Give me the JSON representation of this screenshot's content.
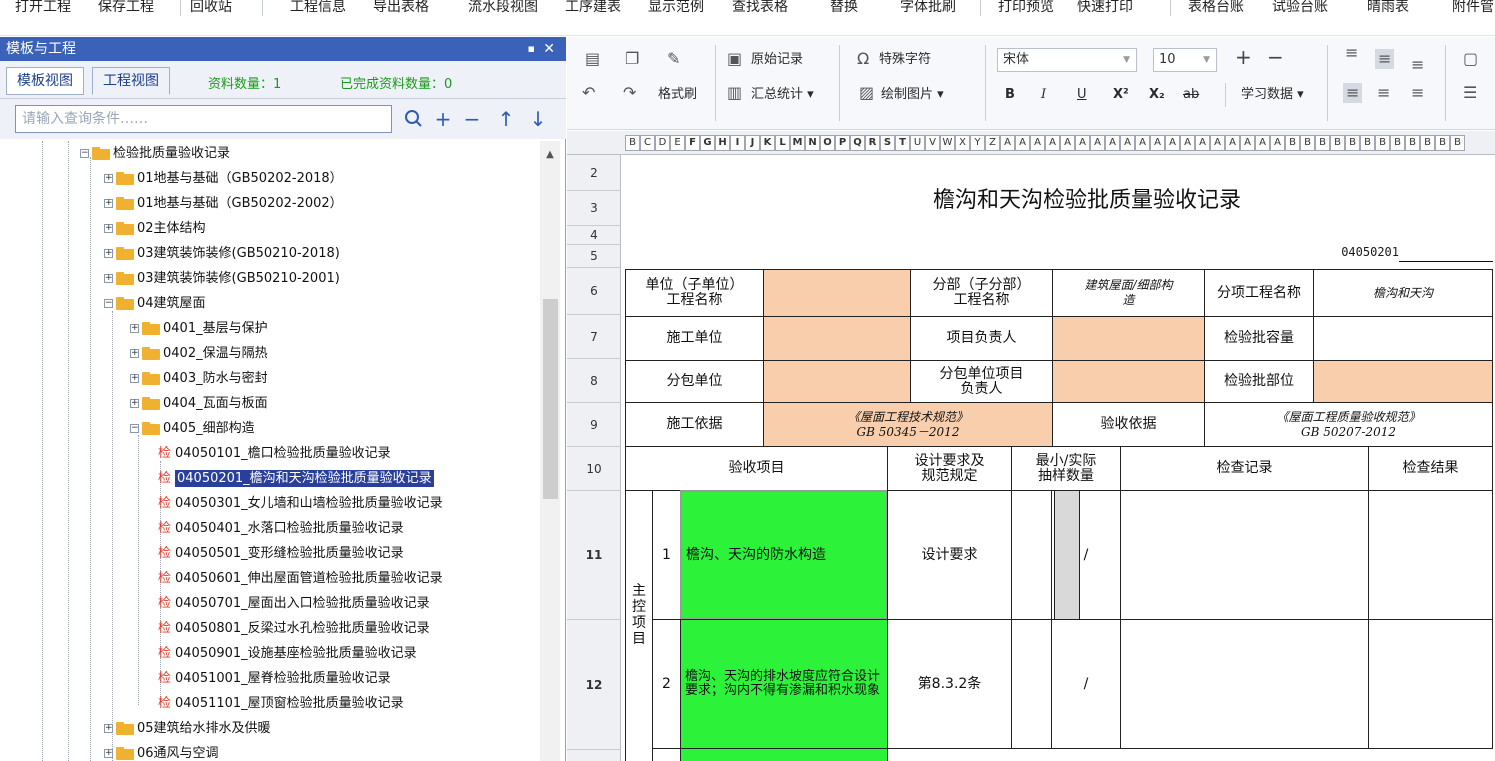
{
  "menu": [
    "打开工程",
    "保存工程",
    "回收站",
    "工程信息",
    "导出表格",
    "流水段视图",
    "工序建表",
    "显示范例",
    "查找表格",
    "替换",
    "字体批刷",
    "打印预览",
    "快速打印",
    "表格台账",
    "试验台账",
    "晴雨表",
    "附件管"
  ],
  "left_panel": {
    "title": "模板与工程",
    "pin": "▪",
    "close": "✕",
    "tabs": [
      "模板视图",
      "工程视图"
    ],
    "count_label": "资料数量：1",
    "done_label": "已完成资料数量：0",
    "search_placeholder": "请输入查询条件……"
  },
  "tree": [
    {
      "label": "检验批质量验收记录",
      "type": "folder",
      "toggle": "−"
    },
    {
      "label": "01地基与基础（GB50202-2018）",
      "type": "folder",
      "toggle": "+"
    },
    {
      "label": "01地基与基础（GB50202-2002）",
      "type": "folder",
      "toggle": "+"
    },
    {
      "label": "02主体结构",
      "type": "folder",
      "toggle": "+"
    },
    {
      "label": "03建筑装饰装修(GB50210-2018)",
      "type": "folder",
      "toggle": "+"
    },
    {
      "label": "03建筑装饰装修(GB50210-2001)",
      "type": "folder",
      "toggle": "+"
    },
    {
      "label": "04建筑屋面",
      "type": "folder",
      "toggle": "−"
    },
    {
      "label": "0401_基层与保护",
      "type": "folder",
      "toggle": "+"
    },
    {
      "label": "0402_保温与隔热",
      "type": "folder",
      "toggle": "+"
    },
    {
      "label": "0403_防水与密封",
      "type": "folder",
      "toggle": "+"
    },
    {
      "label": "0404_瓦面与板面",
      "type": "folder",
      "toggle": "+"
    },
    {
      "label": "0405_细部构造",
      "type": "folder",
      "toggle": "−"
    },
    {
      "label": "04050101_檐口检验批质量验收记录",
      "type": "doc"
    },
    {
      "label": "04050201_檐沟和天沟检验批质量验收记录",
      "type": "doc",
      "selected": true
    },
    {
      "label": "04050301_女儿墙和山墙检验批质量验收记录",
      "type": "doc"
    },
    {
      "label": "04050401_水落口检验批质量验收记录",
      "type": "doc"
    },
    {
      "label": "04050501_变形缝检验批质量验收记录",
      "type": "doc"
    },
    {
      "label": "04050601_伸出屋面管道检验批质量验收记录",
      "type": "doc"
    },
    {
      "label": "04050701_屋面出入口检验批质量验收记录",
      "type": "doc"
    },
    {
      "label": "04050801_反梁过水孔检验批质量验收记录",
      "type": "doc"
    },
    {
      "label": "04050901_设施基座检验批质量验收记录",
      "type": "doc"
    },
    {
      "label": "04051001_屋脊检验批质量验收记录",
      "type": "doc"
    },
    {
      "label": "04051101_屋顶窗检验批质量验收记录",
      "type": "doc"
    },
    {
      "label": "05建筑给水排水及供暖",
      "type": "folder",
      "toggle": "+"
    },
    {
      "label": "06通风与空调",
      "type": "folder",
      "toggle": "+"
    }
  ],
  "doc_glyph": "检",
  "toolbar": {
    "original_record": "原始记录",
    "special_char": "特殊字符",
    "font_name": "宋体",
    "font_size": "10",
    "format_painter": "格式刷",
    "summary": "汇总统计 ▾",
    "draw_image": "绘制图片 ▾",
    "bold": "B",
    "italic": "I",
    "underline": "U",
    "superscript": "X²",
    "subscript": "X₂",
    "strike": "ab",
    "learn_data": "学习数据 ▾",
    "plus": "+",
    "minus": "−"
  },
  "sheet": {
    "columns": [
      "B",
      "C",
      "D",
      "E",
      "F",
      "G",
      "H",
      "I",
      "J",
      "K",
      "L",
      "M",
      "N",
      "O",
      "P",
      "Q",
      "R",
      "S",
      "T",
      "U",
      "V",
      "W",
      "X",
      "Y",
      "Z",
      "A",
      "A",
      "A",
      "A",
      "A",
      "A",
      "A",
      "A",
      "A",
      "A",
      "A",
      "A",
      "A",
      "A",
      "A",
      "A",
      "A",
      "A",
      "A",
      "B",
      "B",
      "B",
      "B",
      "B",
      "B",
      "B",
      "B",
      "B",
      "B",
      "B",
      "B"
    ],
    "rows": [
      "2",
      "3",
      "4",
      "5",
      "6",
      "7",
      "8",
      "9",
      "10",
      "11",
      "12"
    ],
    "title": "檐沟和天沟检验批质量验收记录",
    "code": "04050201",
    "r6": {
      "unit_label": "单位（子单位）\n工程名称",
      "sub_label": "分部（子分部）\n工程名称",
      "sub_value": "建筑屋面/细部构\n造",
      "item_label": "分项工程名称",
      "item_value": "檐沟和天沟"
    },
    "r7": {
      "construct": "施工单位",
      "manager": "项目负责人",
      "capacity": "检验批容量"
    },
    "r8": {
      "subcontract": "分包单位",
      "sub_manager": "分包单位项目\n负责人",
      "position": "检验批部位"
    },
    "r9": {
      "basis_label": "施工依据",
      "basis_value": "《屋面工程技术规范》\nGB 50345－2012",
      "accept_label": "验收依据",
      "accept_value": "《屋面工程质量验收规范》\nGB 50207-2012"
    },
    "r10": {
      "item": "验收项目",
      "design": "设计要求及\n规范规定",
      "sample": "最小/实际\n抽样数量",
      "record": "检查记录",
      "result": "检查结果"
    },
    "main_control": "主\n控\n项\n目",
    "items": [
      {
        "no": "1",
        "text": "檐沟、天沟的防水构造",
        "req": "设计要求",
        "sample": "/"
      },
      {
        "no": "2",
        "text": "檐沟、天沟的排水坡度应符合设计要求；沟内不得有渗漏和积水现象",
        "req": "第8.3.2条",
        "sample": "/"
      }
    ]
  }
}
